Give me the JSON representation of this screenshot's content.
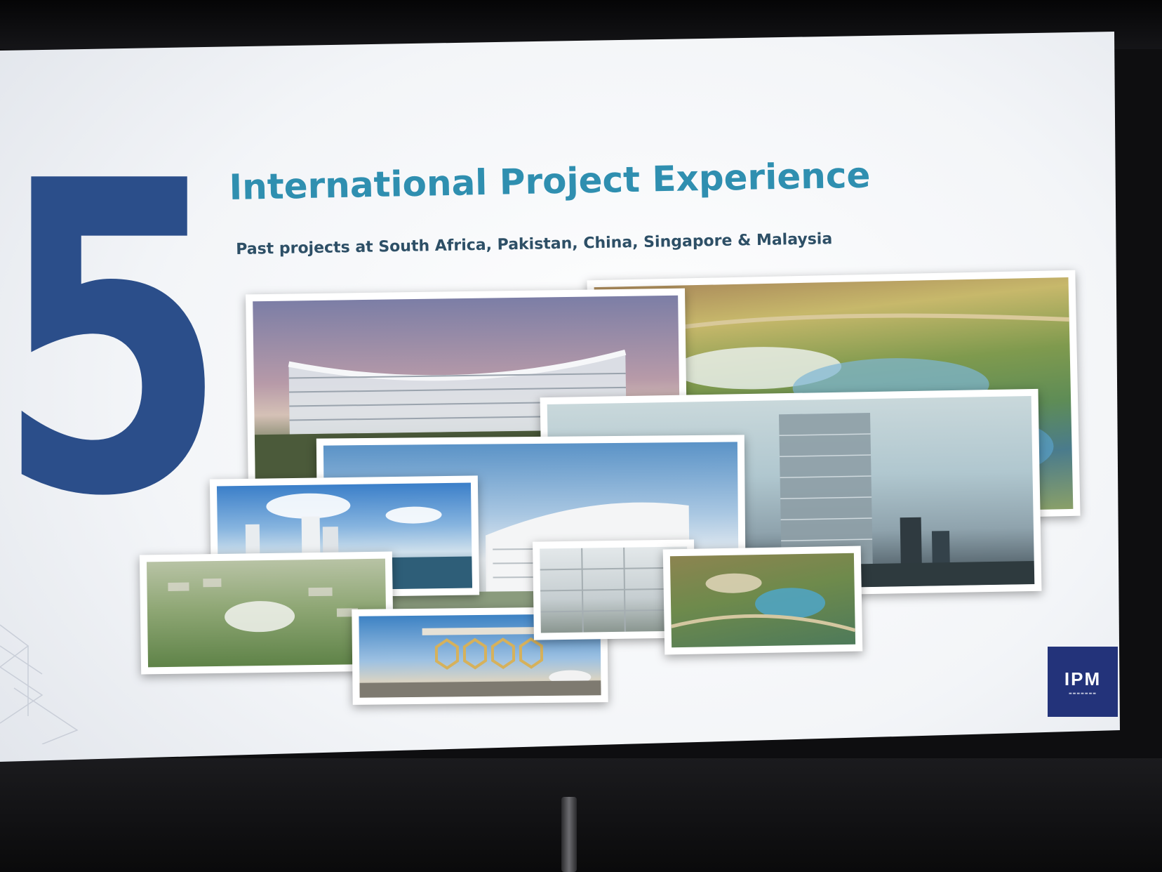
{
  "slide": {
    "number": "5",
    "title": "International Project Experience",
    "subtitle": "Past projects at South Africa, Pakistan, China, Singapore & Malaysia"
  },
  "logo": {
    "mark": "IPM"
  },
  "colors": {
    "number": "#2b4e8a",
    "title": "#2f8fb0",
    "subtitle": "#2d4f66",
    "logo_bg": "#23337a"
  }
}
